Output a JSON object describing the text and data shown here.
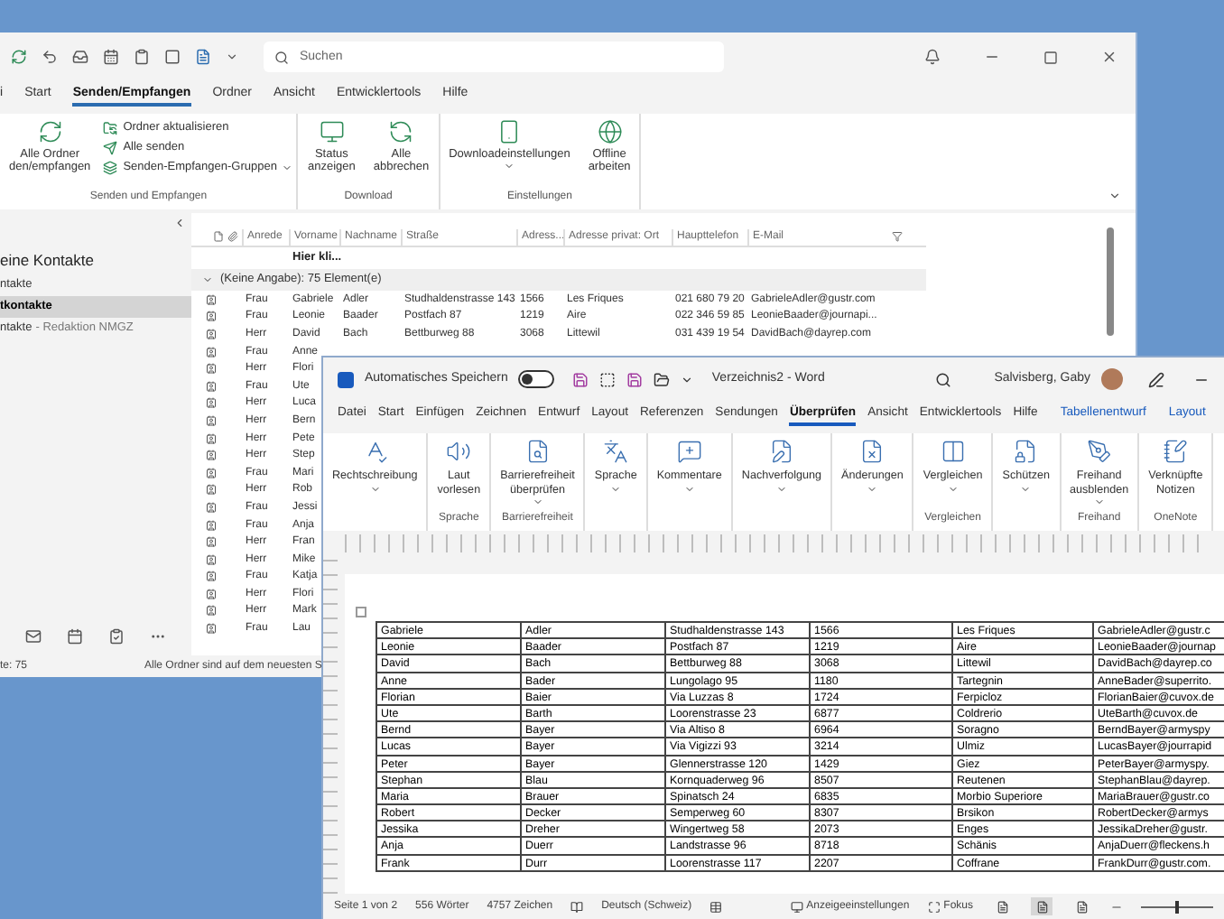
{
  "outlook": {
    "search": {
      "placeholder": "Suchen"
    },
    "tabs": [
      {
        "label": "i",
        "selected": false
      },
      {
        "label": "Start",
        "selected": false
      },
      {
        "label": "Senden/Empfangen",
        "selected": true
      },
      {
        "label": "Ordner",
        "selected": false
      },
      {
        "label": "Ansicht",
        "selected": false
      },
      {
        "label": "Entwicklertools",
        "selected": false
      },
      {
        "label": "Hilfe",
        "selected": false
      }
    ],
    "ribbon_groups": [
      {
        "label": "Senden und Empfangen",
        "buttons": [
          {
            "kind": "large",
            "lines": [
              "Alle Ordner",
              "den/empfangen"
            ],
            "dropdown": false
          },
          {
            "kind": "small",
            "lines": [
              "Ordner aktualisieren"
            ],
            "dropdown": false
          },
          {
            "kind": "small",
            "lines": [
              "Alle senden"
            ],
            "dropdown": false
          },
          {
            "kind": "small",
            "lines": [
              "Senden-Empfangen-Gruppen"
            ],
            "dropdown": true
          }
        ]
      },
      {
        "label": "Download",
        "buttons": [
          {
            "kind": "large",
            "lines": [
              "Status",
              "anzeigen"
            ],
            "dropdown": false
          },
          {
            "kind": "large",
            "lines": [
              "Alle",
              "abbrechen"
            ],
            "dropdown": false
          }
        ]
      },
      {
        "label": "Einstellungen",
        "buttons": [
          {
            "kind": "large",
            "lines": [
              "Downloadeinstellungen"
            ],
            "dropdown": true
          },
          {
            "kind": "large",
            "lines": [
              "Offline",
              "arbeiten"
            ],
            "dropdown": false
          }
        ]
      }
    ],
    "folders": [
      {
        "label": "eine Kontakte",
        "kind": "header"
      },
      {
        "label": "ntakte",
        "kind": "item",
        "selected": false
      },
      {
        "label": "tkontakte",
        "kind": "item",
        "selected": true
      },
      {
        "label": "ntakte",
        "suffix": "- Redaktion NMGZ",
        "kind": "item",
        "selected": false
      }
    ],
    "table": {
      "columns": [
        "Anrede",
        "Vorname",
        "Nachname",
        "Straße",
        "Adress...",
        "Adresse privat: Ort",
        "Haupttelefon",
        "E-Mail"
      ],
      "new_row": "Hier kli...",
      "group": "(Keine Angabe): 75 Element(e)",
      "rows": [
        [
          "Frau",
          "Gabriele",
          "Adler",
          "Studhaldenstrasse 143",
          "1566",
          "Les Friques",
          "021 680 79 20",
          "GabrieleAdler@gustr.com"
        ],
        [
          "Frau",
          "Leonie",
          "Baader",
          "Postfach 87",
          "1219",
          "Aire",
          "022 346 59 85",
          "LeonieBaader@journapi..."
        ],
        [
          "Herr",
          "David",
          "Bach",
          "Bettburweg 88",
          "3068",
          "Littewil",
          "031 439 19 54",
          "DavidBach@dayrep.com"
        ],
        [
          "Frau",
          "Anne"
        ],
        [
          "Herr",
          "Flori"
        ],
        [
          "Frau",
          "Ute"
        ],
        [
          "Herr",
          "Luca"
        ],
        [
          "Herr",
          "Bern"
        ],
        [
          "Herr",
          "Pete"
        ],
        [
          "Herr",
          "Step"
        ],
        [
          "Frau",
          "Mari"
        ],
        [
          "Herr",
          "Rob"
        ],
        [
          "Frau",
          "Jessi"
        ],
        [
          "Frau",
          "Anja"
        ],
        [
          "Herr",
          "Fran"
        ],
        [
          "Herr",
          "Mike"
        ],
        [
          "Frau",
          "Katja"
        ],
        [
          "Herr",
          "Flori"
        ],
        [
          "Herr",
          "Mark"
        ],
        [
          "Frau",
          "Lau"
        ]
      ]
    },
    "status_bar": {
      "left": "te: 75",
      "right": "Alle Ordner sind auf dem neuesten S"
    }
  },
  "word": {
    "autosave": {
      "label": "Automatisches Speichern",
      "on": false
    },
    "title": "Verzeichnis2 - Word",
    "user": "Salvisberg, Gaby",
    "tabs": [
      {
        "label": "Datei",
        "selected": false,
        "contextual": false
      },
      {
        "label": "Start",
        "selected": false,
        "contextual": false
      },
      {
        "label": "Einfügen",
        "selected": false,
        "contextual": false
      },
      {
        "label": "Zeichnen",
        "selected": false,
        "contextual": false
      },
      {
        "label": "Entwurf",
        "selected": false,
        "contextual": false
      },
      {
        "label": "Layout",
        "selected": false,
        "contextual": false
      },
      {
        "label": "Referenzen",
        "selected": false,
        "contextual": false
      },
      {
        "label": "Sendungen",
        "selected": false,
        "contextual": false
      },
      {
        "label": "Überprüfen",
        "selected": true,
        "contextual": false
      },
      {
        "label": "Ansicht",
        "selected": false,
        "contextual": false
      },
      {
        "label": "Entwicklertools",
        "selected": false,
        "contextual": false
      },
      {
        "label": "Hilfe",
        "selected": false,
        "contextual": false
      },
      {
        "label": "Tabellenentwurf",
        "selected": false,
        "contextual": true
      },
      {
        "label": "Layout",
        "selected": false,
        "contextual": true
      }
    ],
    "ribbon_groups": [
      {
        "buttons": [
          {
            "lines": [
              "Rechtschreibung"
            ],
            "dropdown": true
          }
        ]
      },
      {
        "label": "Sprache",
        "buttons": [
          {
            "lines": [
              "Laut",
              "vorlesen"
            ],
            "dropdown": false
          }
        ]
      },
      {
        "label": "Barrierefreiheit",
        "buttons": [
          {
            "lines": [
              "Barrierefreiheit",
              "überprüfen"
            ],
            "dropdown": true
          }
        ]
      },
      {
        "buttons": [
          {
            "lines": [
              "Sprache"
            ],
            "dropdown": true
          }
        ]
      },
      {
        "buttons": [
          {
            "lines": [
              "Kommentare"
            ],
            "dropdown": true
          }
        ]
      },
      {
        "buttons": [
          {
            "lines": [
              "Nachverfolgung"
            ],
            "dropdown": true
          }
        ]
      },
      {
        "buttons": [
          {
            "lines": [
              "Änderungen"
            ],
            "dropdown": true
          }
        ]
      },
      {
        "label": "Vergleichen",
        "buttons": [
          {
            "lines": [
              "Vergleichen"
            ],
            "dropdown": true
          }
        ]
      },
      {
        "buttons": [
          {
            "lines": [
              "Schützen"
            ],
            "dropdown": true
          }
        ]
      },
      {
        "label": "Freihand",
        "buttons": [
          {
            "lines": [
              "Freihand",
              "ausblenden"
            ],
            "dropdown": true
          }
        ]
      },
      {
        "label": "OneNote",
        "buttons": [
          {
            "lines": [
              "Verknüpfte",
              "Notizen"
            ],
            "dropdown": false
          }
        ]
      }
    ],
    "table": [
      [
        "Gabriele",
        "Adler",
        "Studhaldenstrasse 143",
        "1566",
        "Les Friques",
        "GabrieleAdler@gustr.c"
      ],
      [
        "Leonie",
        "Baader",
        "Postfach 87",
        "1219",
        "Aire",
        "LeonieBaader@journap"
      ],
      [
        "David",
        "Bach",
        "Bettburweg 88",
        "3068",
        "Littewil",
        "DavidBach@dayrep.co"
      ],
      [
        "Anne",
        "Bader",
        "Lungolago 95",
        "1180",
        "Tartegnin",
        "AnneBader@superrito."
      ],
      [
        "Florian",
        "Baier",
        "Via Luzzas 8",
        "1724",
        "Ferpicloz",
        "FlorianBaier@cuvox.de"
      ],
      [
        "Ute",
        "Barth",
        "Loorenstrasse 23",
        "6877",
        "Coldrerio",
        "UteBarth@cuvox.de"
      ],
      [
        "Bernd",
        "Bayer",
        "Via Altiso 8",
        "6964",
        "Soragno",
        "BerndBayer@armyspy"
      ],
      [
        "Lucas",
        "Bayer",
        "Via Vigizzi 93",
        "3214",
        "Ulmiz",
        "LucasBayer@jourrapid"
      ],
      [
        "Peter",
        "Bayer",
        "Glennerstrasse 120",
        "1429",
        "Giez",
        "PeterBayer@armyspy."
      ],
      [
        "Stephan",
        "Blau",
        "Kornquaderweg 96",
        "8507",
        "Reutenen",
        "StephanBlau@dayrep."
      ],
      [
        "Maria",
        "Brauer",
        "Spinatsch 24",
        "6835",
        "Morbio Superiore",
        "MariaBrauer@gustr.co"
      ],
      [
        "Robert",
        "Decker",
        "Semperweg 60",
        "8307",
        "Brsikon",
        "RobertDecker@armys"
      ],
      [
        "Jessika",
        "Dreher",
        "Wingertweg 58",
        "2073",
        "Enges",
        "JessikaDreher@gustr."
      ],
      [
        "Anja",
        "Duerr",
        "Landstrasse 96",
        "8718",
        "Schänis",
        "AnjaDuerr@fleckens.h"
      ],
      [
        "Frank",
        "Durr",
        "Loorenstrasse 117",
        "2207",
        "Coffrane",
        "FrankDurr@gustr.com."
      ]
    ],
    "status_bar": [
      "Seite 1 von 2",
      "556 Wörter",
      "4757 Zeichen",
      "Deutsch (Schweiz)"
    ],
    "view_buttons": [
      {
        "label": "Anzeigeeinstellungen"
      },
      {
        "label": "Fokus"
      }
    ],
    "views": [
      {
        "selected": false
      },
      {
        "selected": true
      },
      {
        "selected": false
      }
    ],
    "zoom": {
      "level": 0.5
    }
  }
}
